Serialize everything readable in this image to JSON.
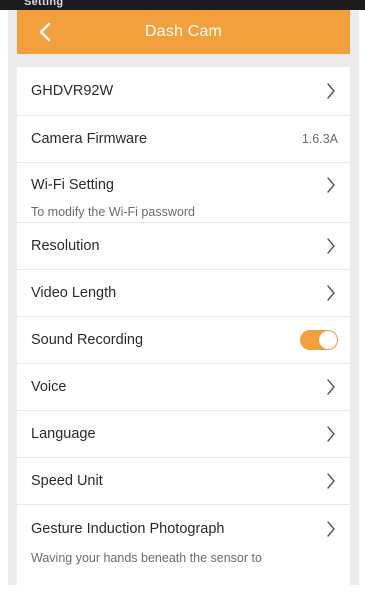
{
  "status_bar": {
    "text": "Setting"
  },
  "header": {
    "title": "Dash Cam",
    "back_icon": "chevron-left-icon",
    "background": "#f2a03d"
  },
  "settings": {
    "device_name": {
      "label": "GHDVR92W"
    },
    "firmware": {
      "label": "Camera Firmware",
      "value": "1.6.3A"
    },
    "wifi": {
      "label": "Wi-Fi Setting",
      "description": "To modify the Wi-Fi password"
    },
    "resolution": {
      "label": "Resolution"
    },
    "video_length": {
      "label": "Video Length"
    },
    "sound_recording": {
      "label": "Sound Recording",
      "enabled": true
    },
    "voice": {
      "label": "Voice"
    },
    "language": {
      "label": "Language"
    },
    "speed_unit": {
      "label": "Speed Unit"
    },
    "gesture": {
      "label": "Gesture Induction Photograph",
      "description": "Waving your hands beneath the sensor to"
    }
  },
  "colors": {
    "accent": "#f2a03d",
    "page_background": "#ececec",
    "list_background": "#ffffff"
  }
}
